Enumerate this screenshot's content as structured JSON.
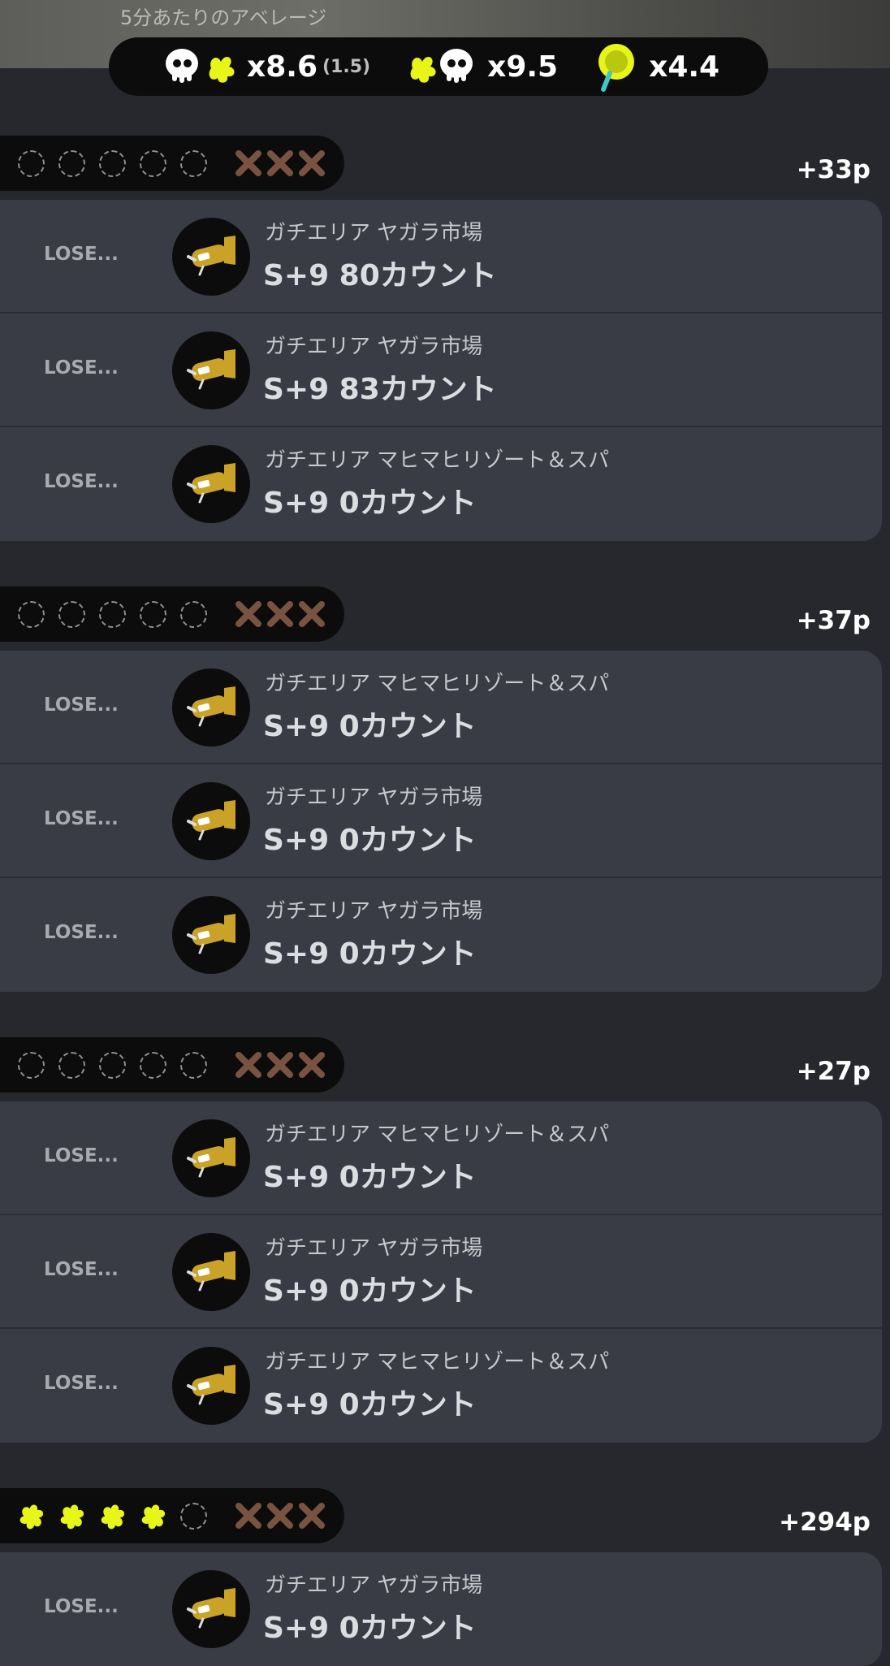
{
  "header": {
    "avg_label": "5分あたりのアベレージ",
    "stats": {
      "kill_assist": "x8.6",
      "assist_sub": "(1.5)",
      "deaths": "x9.5",
      "specials": "x4.4"
    }
  },
  "series": [
    {
      "wins_filled": 0,
      "slots": 5,
      "losses": 3,
      "points": "+33p",
      "matches": [
        {
          "result": "LOSE...",
          "stage": "ガチエリア  ヤガラ市場",
          "rank_count": "S+9  80カウント"
        },
        {
          "result": "LOSE...",
          "stage": "ガチエリア  ヤガラ市場",
          "rank_count": "S+9  83カウント"
        },
        {
          "result": "LOSE...",
          "stage": "ガチエリア  マヒマヒリゾート＆スパ",
          "rank_count": "S+9  0カウント"
        }
      ]
    },
    {
      "wins_filled": 0,
      "slots": 5,
      "losses": 3,
      "points": "+37p",
      "matches": [
        {
          "result": "LOSE...",
          "stage": "ガチエリア  マヒマヒリゾート＆スパ",
          "rank_count": "S+9  0カウント"
        },
        {
          "result": "LOSE...",
          "stage": "ガチエリア  ヤガラ市場",
          "rank_count": "S+9  0カウント"
        },
        {
          "result": "LOSE...",
          "stage": "ガチエリア  ヤガラ市場",
          "rank_count": "S+9  0カウント"
        }
      ]
    },
    {
      "wins_filled": 0,
      "slots": 5,
      "losses": 3,
      "points": "+27p",
      "matches": [
        {
          "result": "LOSE...",
          "stage": "ガチエリア  マヒマヒリゾート＆スパ",
          "rank_count": "S+9  0カウント"
        },
        {
          "result": "LOSE...",
          "stage": "ガチエリア  ヤガラ市場",
          "rank_count": "S+9  0カウント"
        },
        {
          "result": "LOSE...",
          "stage": "ガチエリア  マヒマヒリゾート＆スパ",
          "rank_count": "S+9  0カウント"
        }
      ]
    },
    {
      "wins_filled": 4,
      "slots": 5,
      "losses": 3,
      "points": "+294p",
      "matches": [
        {
          "result": "LOSE...",
          "stage": "ガチエリア  ヤガラ市場",
          "rank_count": "S+9  0カウント"
        }
      ]
    }
  ],
  "colors": {
    "background": "#26282e",
    "card": "#393c45",
    "pill": "#0c0c0c",
    "ink_yellow": "#e8f518",
    "loss_x": "#7a5240",
    "weapon_gold": "#c9a227"
  },
  "icons": [
    "squid-kill-icon",
    "splat-death-icon",
    "special-weapon-icon",
    "ink-splat-win-icon",
    "loss-x-icon",
    "weapon-icon"
  ]
}
